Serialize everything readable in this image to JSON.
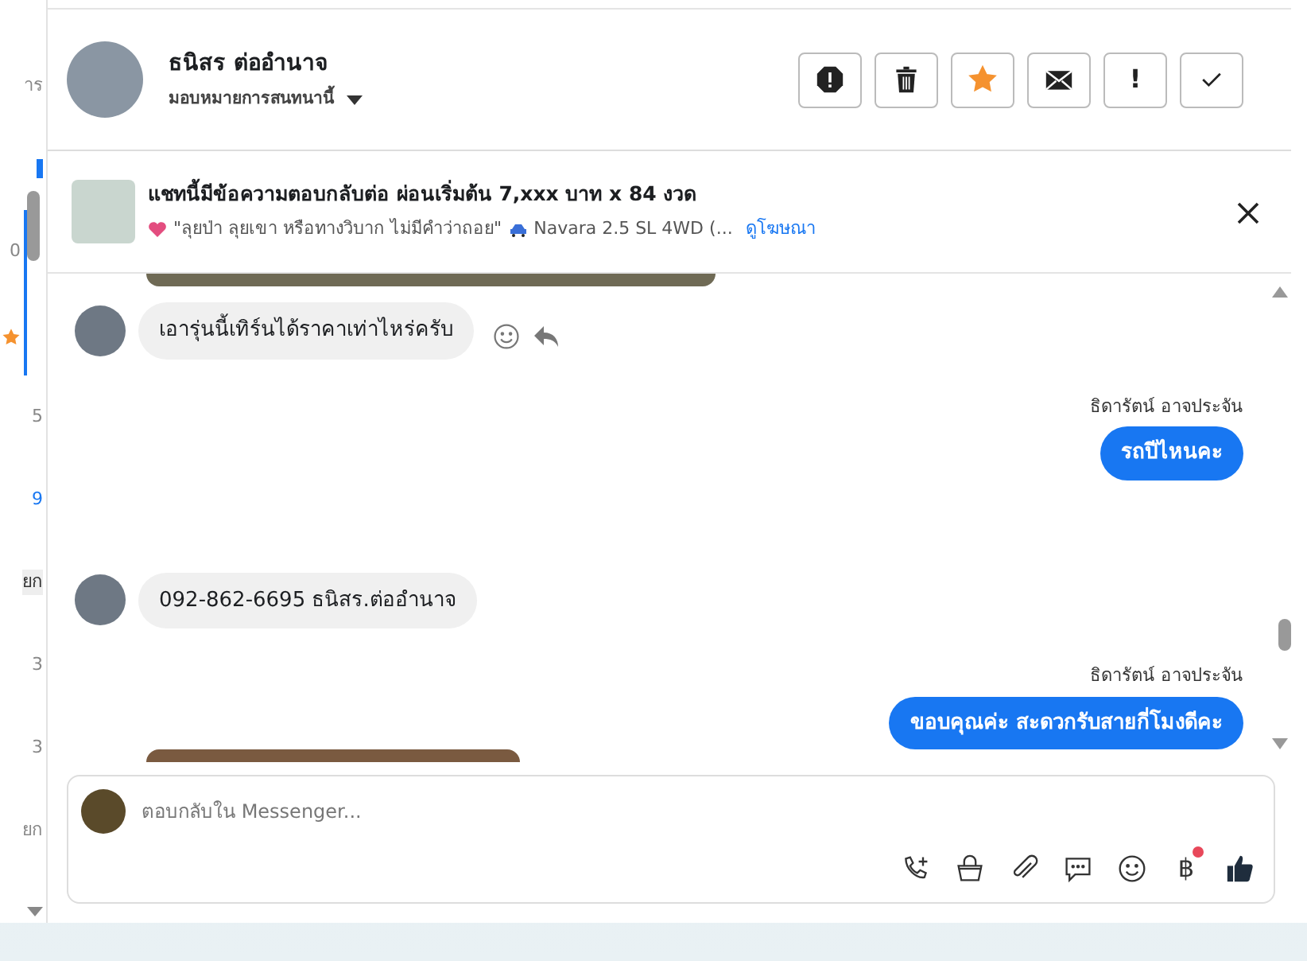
{
  "side_list": [
    {
      "text": "าร",
      "kind": "plain"
    },
    {
      "kind": "mark"
    },
    {
      "text": "0",
      "kind": "plain",
      "selected": true
    },
    {
      "kind": "star",
      "selected": true
    },
    {
      "text": "5",
      "kind": "plain"
    },
    {
      "text": "9",
      "kind": "link"
    },
    {
      "text": "ยก",
      "kind": "starred"
    },
    {
      "text": "3",
      "kind": "plain"
    },
    {
      "text": "3",
      "kind": "plain"
    },
    {
      "text": "ยก",
      "kind": "plain"
    }
  ],
  "contact": {
    "name": "ธนิสร ต่ออำนาจ",
    "assign": "มอบหมายการสนทนานี้"
  },
  "actions": [
    {
      "kind": "alert"
    },
    {
      "kind": "trash"
    },
    {
      "kind": "star",
      "on": true
    },
    {
      "kind": "mail"
    },
    {
      "kind": "exclaim",
      "label": "!"
    },
    {
      "kind": "check"
    }
  ],
  "ad": {
    "title": "แชทนี้มีข้อความตอบกลับต่อ ผ่อนเริ่มต้น 7,xxx บาท x 84 งวด",
    "subtitle": "\"ลุยป่า ลุยเขา หรือทางวิบาก ไม่มีคำว่าถอย\"",
    "car": "Navara 2.5 SL 4WD (...",
    "link": "ดูโฆษณา"
  },
  "messages": [
    {
      "kind": "photo"
    },
    {
      "kind": "in",
      "text": "เอารุ่นนี้เทิร์นได้ราคาเท่าไหร่ครับ",
      "tools": true
    },
    {
      "kind": "out",
      "sender": "ธิดารัตน์ อาจประจัน",
      "text": "รถปีไหนคะ"
    },
    {
      "kind": "in",
      "text": "092-862-6695 ธนิสร.ต่ออำนาจ",
      "tools": false
    },
    {
      "kind": "out",
      "sender": "ธิดารัตน์ อาจประจัน",
      "text": "ขอบคุณค่ะ สะดวกรับสายกี่โมงดีคะ"
    },
    {
      "kind": "photo"
    }
  ],
  "composer": {
    "placeholder": "ตอบกลับใน Messenger...",
    "tools": [
      {
        "kind": "call"
      },
      {
        "kind": "bag"
      },
      {
        "kind": "clip"
      },
      {
        "kind": "chat"
      },
      {
        "kind": "smile"
      },
      {
        "kind": "baht",
        "label": "฿",
        "dot": true
      },
      {
        "kind": "like"
      }
    ]
  }
}
